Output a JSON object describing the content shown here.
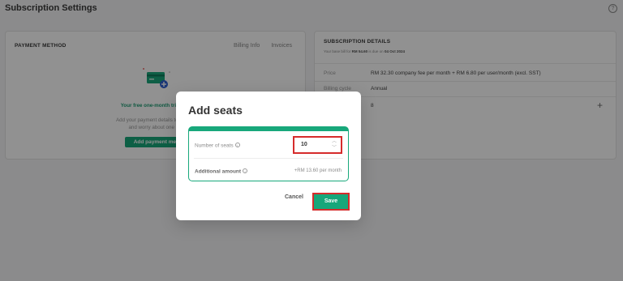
{
  "header": {
    "title": "Subscription Settings",
    "help_icon": "?"
  },
  "payment_method": {
    "title": "PAYMENT METHOD",
    "tabs": [
      "Billing Info",
      "Invoices"
    ],
    "trial_text": "Your free one-month trial is e",
    "add_info_line1": "Add your payment details to enable",
    "add_info_line2": "and worry about one les",
    "add_button": "Add payment meth"
  },
  "subscription": {
    "title": "SUBSCRIPTION DETAILS",
    "note_prefix": "Your base bill for",
    "note_amount": "RM 54.60",
    "note_middle": "is due on",
    "note_date": "04 Oct 2024",
    "rows": [
      {
        "label": "Price",
        "value": "RM 32.30 company fee per month + RM 6.80 per user/month (excl. SST)"
      },
      {
        "label": "Billing cycle",
        "value": "Annual"
      },
      {
        "label": "",
        "value": "8"
      }
    ]
  },
  "modal": {
    "title": "Add seats",
    "seats_label": "Number of seats",
    "seats_value": "10",
    "amount_label": "Additional amount",
    "amount_value": "+RM 13.60 per month",
    "cancel": "Cancel",
    "save": "Save",
    "info_icon": "i"
  },
  "colors": {
    "accent": "#17a77a",
    "highlight": "#d62c2c",
    "overlay": "rgba(0,0,0,0.43)"
  }
}
